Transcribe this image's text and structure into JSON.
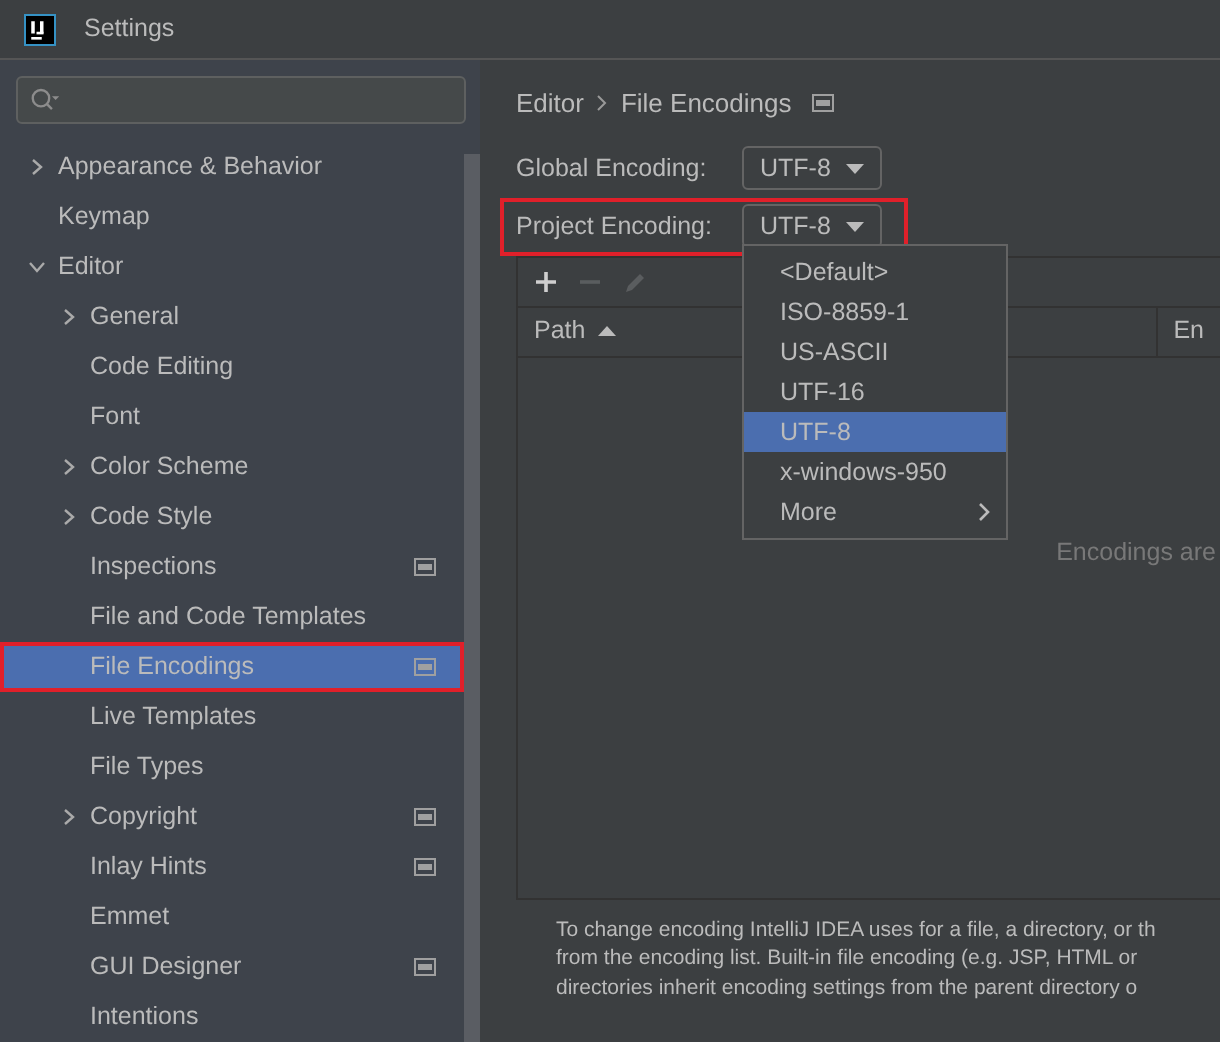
{
  "window": {
    "title": "Settings"
  },
  "sidebar": {
    "items": [
      {
        "label": "Appearance & Behavior",
        "kind": "group",
        "expanded": false,
        "selected": false,
        "project_scoped": false,
        "highlighted": false
      },
      {
        "label": "Keymap",
        "kind": "page",
        "selected": false,
        "project_scoped": false,
        "highlighted": false
      },
      {
        "label": "Editor",
        "kind": "group",
        "expanded": true,
        "selected": false,
        "project_scoped": false,
        "highlighted": false,
        "children": [
          {
            "label": "General",
            "kind": "group",
            "expanded": false,
            "selected": false,
            "project_scoped": false,
            "highlighted": false
          },
          {
            "label": "Code Editing",
            "kind": "page",
            "selected": false,
            "project_scoped": false,
            "highlighted": false
          },
          {
            "label": "Font",
            "kind": "page",
            "selected": false,
            "project_scoped": false,
            "highlighted": false
          },
          {
            "label": "Color Scheme",
            "kind": "group",
            "expanded": false,
            "selected": false,
            "project_scoped": false,
            "highlighted": false
          },
          {
            "label": "Code Style",
            "kind": "group",
            "expanded": false,
            "selected": false,
            "project_scoped": false,
            "highlighted": false
          },
          {
            "label": "Inspections",
            "kind": "page",
            "selected": false,
            "project_scoped": true,
            "highlighted": false
          },
          {
            "label": "File and Code Templates",
            "kind": "page",
            "selected": false,
            "project_scoped": false,
            "highlighted": false
          },
          {
            "label": "File Encodings",
            "kind": "page",
            "selected": true,
            "project_scoped": true,
            "highlighted": true
          },
          {
            "label": "Live Templates",
            "kind": "page",
            "selected": false,
            "project_scoped": false,
            "highlighted": false
          },
          {
            "label": "File Types",
            "kind": "page",
            "selected": false,
            "project_scoped": false,
            "highlighted": false
          },
          {
            "label": "Copyright",
            "kind": "group",
            "expanded": false,
            "selected": false,
            "project_scoped": true,
            "highlighted": false
          },
          {
            "label": "Inlay Hints",
            "kind": "page",
            "selected": false,
            "project_scoped": true,
            "highlighted": false
          },
          {
            "label": "Emmet",
            "kind": "page",
            "selected": false,
            "project_scoped": false,
            "highlighted": false
          },
          {
            "label": "GUI Designer",
            "kind": "page",
            "selected": false,
            "project_scoped": true,
            "highlighted": false
          },
          {
            "label": "Intentions",
            "kind": "page",
            "selected": false,
            "project_scoped": false,
            "highlighted": false
          }
        ]
      }
    ]
  },
  "breadcrumb": {
    "items": [
      "Editor",
      "File Encodings"
    ],
    "project_scoped": true
  },
  "fields": [
    {
      "label": "Global Encoding:",
      "value": "UTF-8",
      "highlighted": false
    },
    {
      "label": "Project Encoding:",
      "value": "UTF-8",
      "highlighted": true
    }
  ],
  "dropdown": {
    "options": [
      {
        "label": "<Default>",
        "selected": false,
        "kind": "item"
      },
      {
        "label": "ISO-8859-1",
        "selected": false,
        "kind": "item"
      },
      {
        "label": "US-ASCII",
        "selected": false,
        "kind": "item"
      },
      {
        "label": "UTF-16",
        "selected": false,
        "kind": "item"
      },
      {
        "label": "UTF-8",
        "selected": true,
        "kind": "item"
      },
      {
        "label": "x-windows-950",
        "selected": false,
        "kind": "item"
      },
      {
        "label": "More",
        "selected": false,
        "kind": "submenu"
      }
    ]
  },
  "table": {
    "toolbar": [
      {
        "kind": "add",
        "disabled": false
      },
      {
        "kind": "remove",
        "disabled": true
      },
      {
        "kind": "edit",
        "disabled": true
      }
    ],
    "columns": [
      {
        "label": "Path",
        "sorted_ascending": true
      },
      {
        "label": "En",
        "sorted_ascending": false
      }
    ],
    "empty_text": "Encodings are"
  },
  "description": [
    "To change encoding IntelliJ IDEA uses for a file, a directory, or th",
    "from the encoding list. Built-in file encoding (e.g. JSP, HTML or",
    "directories inherit encoding settings from the parent directory o"
  ]
}
